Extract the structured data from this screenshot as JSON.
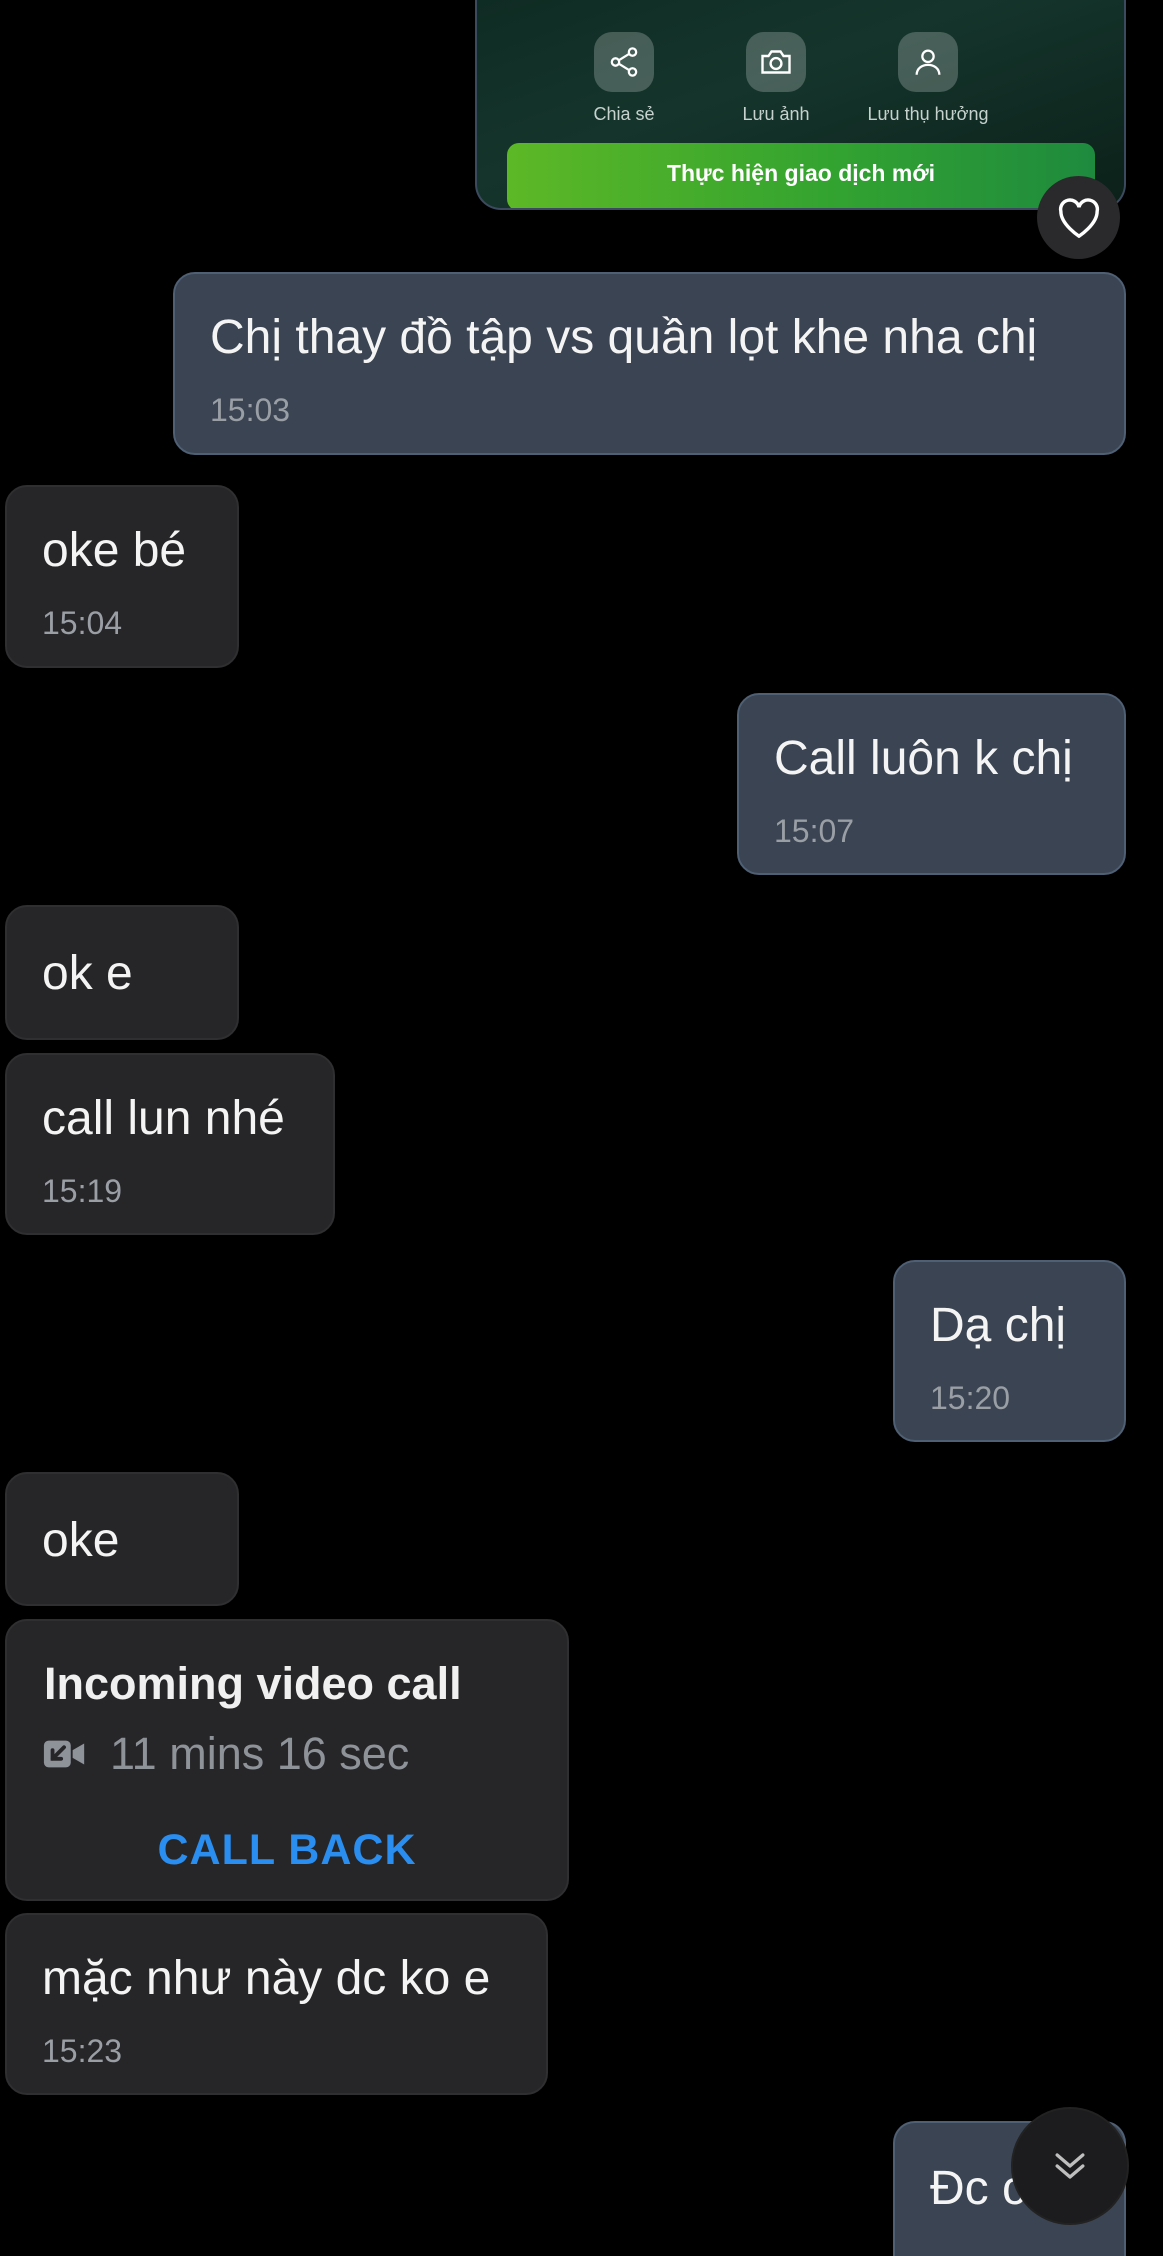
{
  "transaction_card": {
    "actions": [
      {
        "label": "Chia sẻ",
        "icon": "share-icon"
      },
      {
        "label": "Lưu ảnh",
        "icon": "camera-icon"
      },
      {
        "label": "Lưu thụ hưởng",
        "icon": "person-icon"
      }
    ],
    "new_transaction_label": "Thực hiện giao dịch mới"
  },
  "reaction_icon": "heart-icon",
  "messages": [
    {
      "direction": "outgoing",
      "text": "Chị thay đồ tập vs quần lọt khe nha chị",
      "time": "15:03"
    },
    {
      "direction": "incoming",
      "text": "oke bé",
      "time": "15:04"
    },
    {
      "direction": "outgoing",
      "text": "Call luôn k chị",
      "time": "15:07"
    },
    {
      "direction": "incoming",
      "text": "ok e",
      "time": ""
    },
    {
      "direction": "incoming",
      "text": "call lun nhé",
      "time": "15:19"
    },
    {
      "direction": "outgoing",
      "text": "Dạ chị",
      "time": "15:20"
    },
    {
      "direction": "incoming",
      "text": "oke",
      "time": ""
    },
    {
      "direction": "incoming",
      "text": "mặc như này dc ko e",
      "time": "15:23"
    },
    {
      "direction": "outgoing",
      "text": "Đc c",
      "time": ""
    }
  ],
  "call": {
    "title": "Incoming video call",
    "duration": "11 mins 16 sec",
    "action_label": "CALL BACK",
    "icon": "incoming-video-call-icon",
    "action_color": "#2a8df0"
  },
  "scroll_button_icon": "double-chevron-down-icon",
  "colors": {
    "background": "#000000",
    "outgoing_bubble": "#3a4452",
    "incoming_bubble": "#262628",
    "accent_green": "#33a330"
  }
}
